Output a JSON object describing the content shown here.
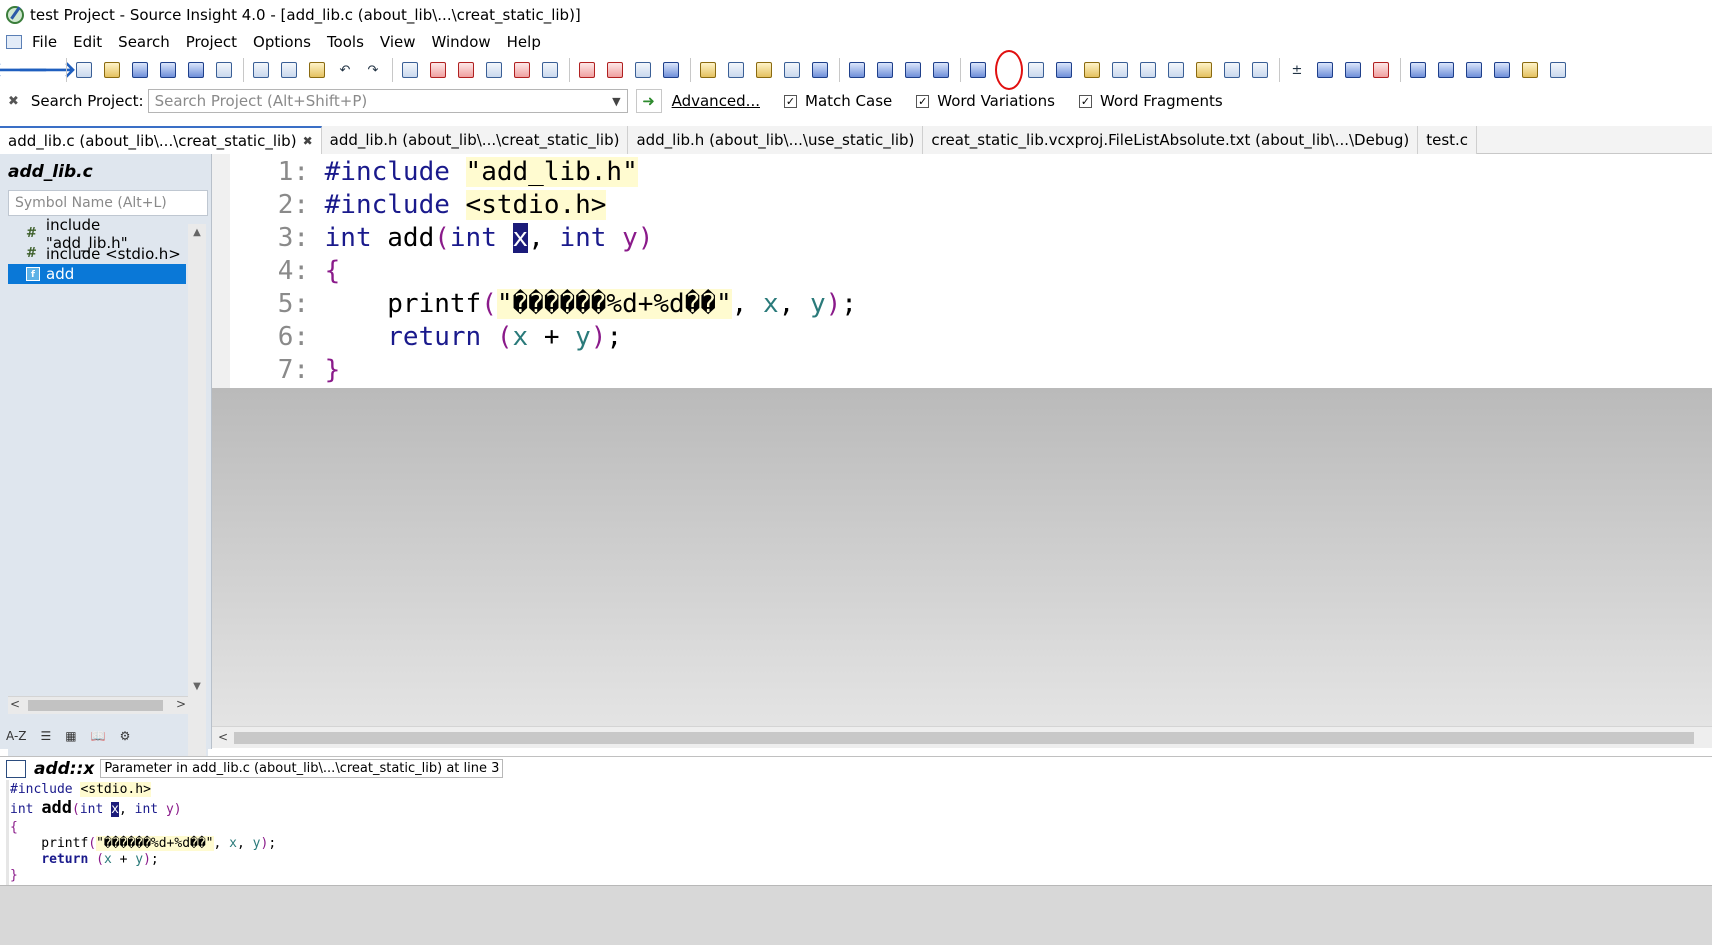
{
  "window": {
    "title": "test Project - Source Insight 4.0 - [add_lib.c (about_lib\\...\\creat_static_lib)]"
  },
  "menu": [
    "File",
    "Edit",
    "Search",
    "Project",
    "Options",
    "Tools",
    "View",
    "Window",
    "Help"
  ],
  "search": {
    "label": "Search Project:",
    "placeholder": "Search Project (Alt+Shift+P)",
    "advanced": "Advanced...",
    "options": [
      {
        "label": "Match Case",
        "checked": true
      },
      {
        "label": "Word Variations",
        "checked": true
      },
      {
        "label": "Word Fragments",
        "checked": true
      }
    ]
  },
  "tabs": [
    {
      "label": "add_lib.c (about_lib\\...\\creat_static_lib)",
      "active": true
    },
    {
      "label": "add_lib.h (about_lib\\...\\creat_static_lib)",
      "active": false
    },
    {
      "label": "add_lib.h (about_lib\\...\\use_static_lib)",
      "active": false
    },
    {
      "label": "creat_static_lib.vcxproj.FileListAbsolute.txt (about_lib\\...\\Debug)",
      "active": false
    },
    {
      "label": "test.c",
      "active": false
    }
  ],
  "sidebar": {
    "title": "add_lib.c",
    "symbol_placeholder": "Symbol Name (Alt+L)",
    "symbols": [
      {
        "label": "include \"add_lib.h\"",
        "selected": false
      },
      {
        "label": "include <stdio.h>",
        "selected": false
      },
      {
        "label": "add",
        "selected": true
      }
    ],
    "bottom_icons": [
      "A-Z",
      "list-icon",
      "category-icon",
      "book-icon",
      "gear-icon"
    ]
  },
  "editor": {
    "lines": [
      {
        "n": "1:",
        "text": "#include \"add_lib.h\""
      },
      {
        "n": "2:",
        "text": "#include <stdio.h>"
      },
      {
        "n": "3:",
        "text": "int add(int x, int y)"
      },
      {
        "n": "4:",
        "text": "{"
      },
      {
        "n": "5:",
        "text": "    printf(\"������%d+%d��\", x, y);"
      },
      {
        "n": "6:",
        "text": "    return (x + y);"
      },
      {
        "n": "7:",
        "text": "}"
      }
    ]
  },
  "context": {
    "symbol": "add::x",
    "description": "Parameter in add_lib.c (about_lib\\...\\creat_static_lib) at line 3",
    "lines": [
      "#include <stdio.h>",
      "int add(int x, int y)",
      "{",
      "    printf(\"������%d+%d��\", x, y);",
      "    return (x + y);",
      "}"
    ]
  }
}
